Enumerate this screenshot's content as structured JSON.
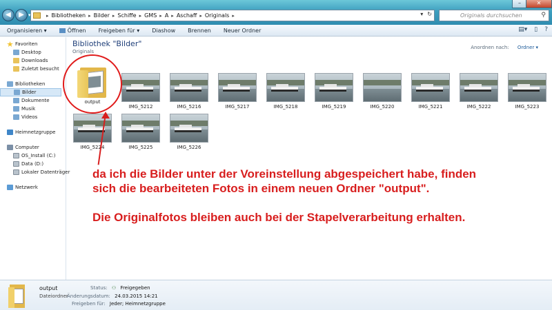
{
  "window": {
    "minimize": "–",
    "maximize": "□",
    "close": "✕"
  },
  "address": {
    "crumbs": [
      "Bibliotheken",
      "Bilder",
      "Schiffe",
      "GMS",
      "A",
      "Aschaff",
      "Originals"
    ],
    "search_placeholder": "Originals durchsuchen"
  },
  "toolbar": {
    "organize": "Organisieren ▾",
    "open": "Öffnen",
    "share": "Freigeben für ▾",
    "slideshow": "Diashow",
    "burn": "Brennen",
    "new_folder": "Neuer Ordner"
  },
  "sidebar": {
    "favorites": "Favoriten",
    "desktop": "Desktop",
    "downloads": "Downloads",
    "recent": "Zuletzt besucht",
    "libraries": "Bibliotheken",
    "pictures": "Bilder",
    "documents": "Dokumente",
    "music": "Musik",
    "videos": "Videos",
    "homegroup": "Heimnetzgruppe",
    "computer": "Computer",
    "drive_c": "OS_Install (C:)",
    "drive_d": "Data (D:)",
    "drive_local": "Lokaler Datenträger",
    "network": "Netzwerk"
  },
  "content": {
    "title": "Bibliothek \"Bilder\"",
    "subtitle": "Originals",
    "arrange_label": "Anordnen nach:",
    "arrange_value": "Ordner ▾"
  },
  "items": {
    "folder": "output",
    "photos": [
      "IMG_5212",
      "IMG_5216",
      "IMG_5217",
      "IMG_5218",
      "IMG_5219",
      "IMG_5220",
      "IMG_5221",
      "IMG_5222",
      "IMG_5223",
      "IMG_5224",
      "IMG_5225",
      "IMG_5226"
    ]
  },
  "annotation": {
    "line1": "da ich die Bilder unter der Voreinstellung abgespeichert habe, finden sich die bearbeiteten Fotos in einem neuen Ordner \"output\".",
    "line2": "Die Originalfotos bleiben auch bei der Stapelverarbeitung erhalten."
  },
  "details": {
    "name": "output",
    "type": "Dateiordner",
    "status_label": "Status:",
    "status_value": "Freigegeben",
    "modified_label": "Änderungsdatum:",
    "modified_value": "24.03.2015 14:21",
    "shared_label": "Freigeben für:",
    "shared_value": "Jeder; Heimnetzgruppe"
  },
  "colors": {
    "annotation": "#d81e1e",
    "title": "#1e3e78"
  }
}
